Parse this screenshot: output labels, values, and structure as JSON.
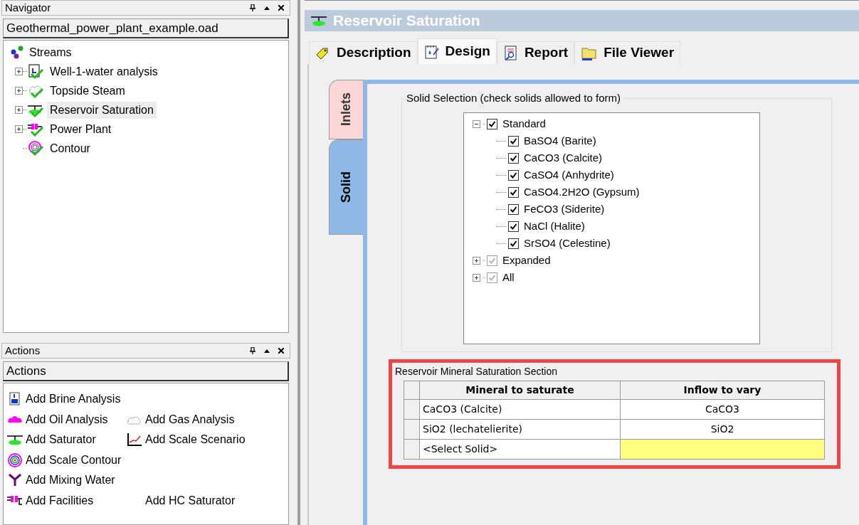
{
  "navigator": {
    "title": "Navigator",
    "file": "Geothermal_power_plant_example.oad",
    "root": {
      "label": "Streams",
      "children": [
        {
          "label": "Well-1-water analysis",
          "expandable": true,
          "selected": false
        },
        {
          "label": "Topside Steam",
          "expandable": true,
          "selected": false
        },
        {
          "label": "Reservoir Saturation",
          "expandable": true,
          "selected": true
        },
        {
          "label": "Power Plant",
          "expandable": true,
          "selected": false
        },
        {
          "label": "Contour",
          "expandable": false,
          "selected": false
        }
      ]
    }
  },
  "actions": {
    "title": "Actions",
    "header": "Actions",
    "rows": [
      [
        {
          "label": "Add Brine Analysis"
        }
      ],
      [
        {
          "label": "Add Oil Analysis"
        },
        {
          "label": "Add Gas Analysis"
        }
      ],
      [
        {
          "label": "Add Saturator"
        },
        {
          "label": "Add Scale Scenario"
        }
      ],
      [
        {
          "label": "Add Scale Contour"
        }
      ],
      [
        {
          "label": "Add Mixing Water"
        }
      ],
      [
        {
          "label": "Add Facilities"
        },
        {
          "label": "Add HC Saturator"
        }
      ]
    ]
  },
  "document": {
    "title": "Reservoir Saturation",
    "tabs": [
      {
        "label": "Description",
        "selected": false
      },
      {
        "label": "Design",
        "selected": true
      },
      {
        "label": "Report",
        "selected": false
      },
      {
        "label": "File Viewer",
        "selected": false
      }
    ],
    "side_tabs": [
      {
        "label": "Inlets",
        "selected": false
      },
      {
        "label": "Solid",
        "selected": true
      }
    ],
    "solid_selection": {
      "title": "Solid Selection (check solids allowed to form)",
      "groups": [
        {
          "label": "Standard",
          "checked": true,
          "greyed": false,
          "expanded": true,
          "children": [
            {
              "label": "BaSO4 (Barite)",
              "checked": true
            },
            {
              "label": "CaCO3 (Calcite)",
              "checked": true
            },
            {
              "label": "CaSO4 (Anhydrite)",
              "checked": true
            },
            {
              "label": "CaSO4.2H2O (Gypsum)",
              "checked": true
            },
            {
              "label": "FeCO3 (Siderite)",
              "checked": true
            },
            {
              "label": "NaCl (Halite)",
              "checked": true
            },
            {
              "label": "SrSO4 (Celestine)",
              "checked": true
            }
          ]
        },
        {
          "label": "Expanded",
          "checked": true,
          "greyed": true,
          "expanded": false
        },
        {
          "label": "All",
          "checked": true,
          "greyed": true,
          "expanded": false
        }
      ]
    },
    "saturation": {
      "title": "Reservoir Mineral Saturation Section",
      "columns": [
        "Mineral to saturate",
        "Inflow to vary"
      ],
      "rows": [
        {
          "mineral": "CaCO3 (Calcite)",
          "inflow": "CaCO3",
          "highlighted": false
        },
        {
          "mineral": "SiO2 (lechatelierite)",
          "inflow": "SiO2",
          "highlighted": false
        },
        {
          "mineral": "<Select Solid>",
          "highlighted": true
        }
      ]
    }
  }
}
